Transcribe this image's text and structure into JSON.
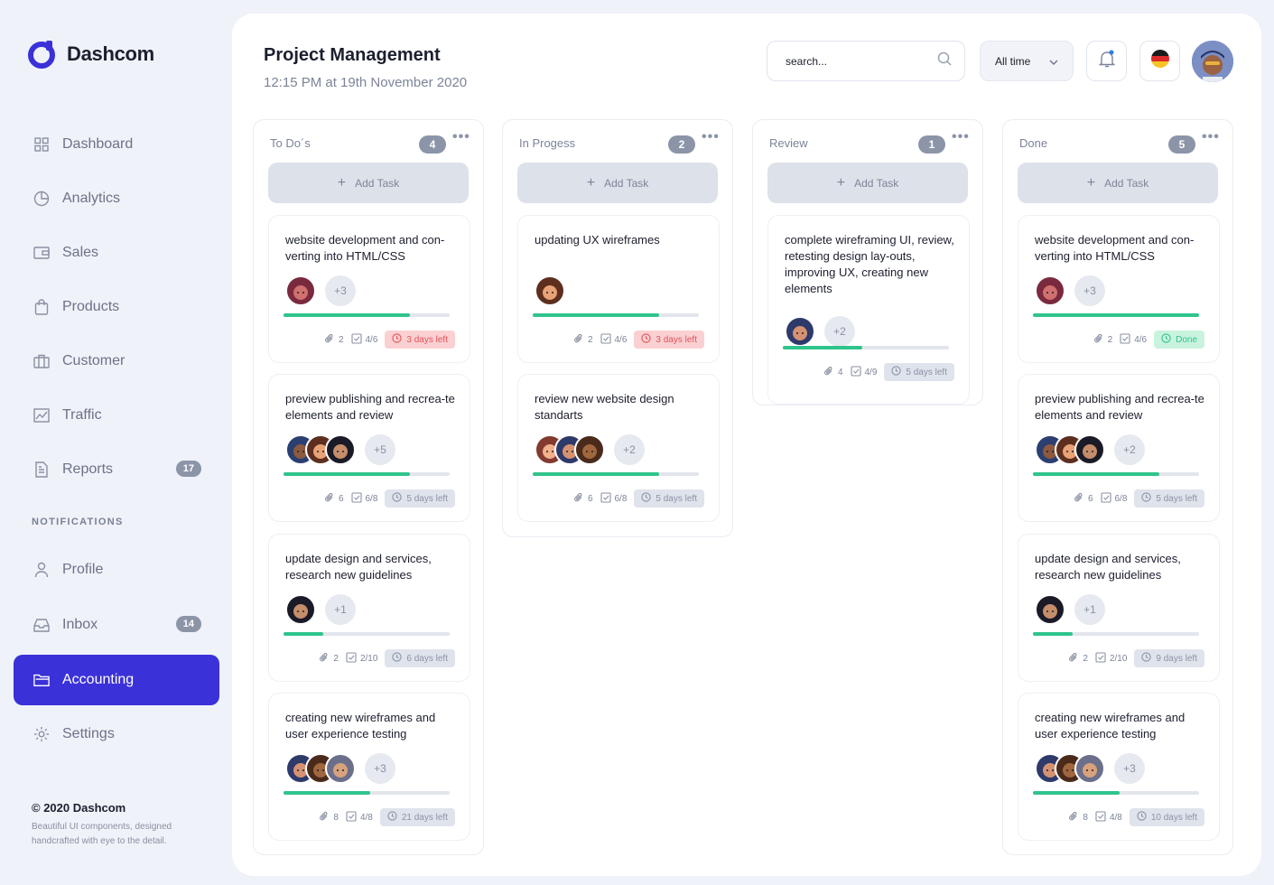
{
  "brand": {
    "name": "Dashcom"
  },
  "sidebar": {
    "items": [
      {
        "label": "Dashboard",
        "icon": "grid-icon"
      },
      {
        "label": "Analytics",
        "icon": "pie-chart-icon"
      },
      {
        "label": "Sales",
        "icon": "wallet-icon"
      },
      {
        "label": "Products",
        "icon": "shopping-bag-icon"
      },
      {
        "label": "Customer",
        "icon": "briefcase-icon"
      },
      {
        "label": "Traffic",
        "icon": "line-chart-icon"
      },
      {
        "label": "Reports",
        "icon": "document-icon",
        "badge": "17"
      }
    ],
    "section_label": "NOTIFICATIONS",
    "items2": [
      {
        "label": "Profile",
        "icon": "user-icon"
      },
      {
        "label": "Inbox",
        "icon": "inbox-icon",
        "badge": "14"
      },
      {
        "label": "Accounting",
        "icon": "folder-icon",
        "active": true
      },
      {
        "label": "Settings",
        "icon": "gear-icon"
      }
    ],
    "footer": {
      "copyright": "© 2020 Dashcom",
      "note": "Beautiful UI components, designed handcrafted with eye to the detail."
    }
  },
  "header": {
    "title": "Project Management",
    "subtitle": "12:15 PM at 19th November 2020",
    "search_placeholder": "search...",
    "filter_value": "All time"
  },
  "colors": {
    "accent": "#3b31d8",
    "progress": "#2fc48b",
    "badge": "#8c95a8"
  },
  "board": {
    "add_task_label": "Add Task",
    "columns": [
      {
        "title": "To Do´s",
        "count": "4",
        "cards": [
          {
            "title": "website development and con-verting into HTML/CSS",
            "more": "+3",
            "progress": 0.76,
            "attachments": "2",
            "checks": "4/6",
            "due": "3 days left",
            "due_style": "red"
          },
          {
            "title": "preview publishing and recrea-te elements and review",
            "more": "+5",
            "progress": 0.76,
            "attachments": "6",
            "checks": "6/8",
            "due": "5 days left",
            "due_style": "gray"
          },
          {
            "title": "update design and services, research new guidelines",
            "more": "+1",
            "progress": 0.24,
            "attachments": "2",
            "checks": "2/10",
            "due": "6 days left",
            "due_style": "gray"
          },
          {
            "title": "creating new wireframes and user experience testing",
            "more": "+3",
            "progress": 0.52,
            "attachments": "8",
            "checks": "4/8",
            "due": "21 days left",
            "due_style": "gray"
          }
        ]
      },
      {
        "title": "In Progess",
        "count": "2",
        "cards": [
          {
            "title": "updating UX wireframes",
            "more": "",
            "progress": 0.76,
            "attachments": "2",
            "checks": "4/6",
            "due": "3 days left",
            "due_style": "red"
          },
          {
            "title": "review new website design standarts",
            "more": "+2",
            "progress": 0.76,
            "attachments": "6",
            "checks": "6/8",
            "due": "5 days left",
            "due_style": "gray"
          }
        ]
      },
      {
        "title": "Review",
        "count": "1",
        "cards": [
          {
            "title": "complete wireframing UI, review, retesting design lay-outs, improving UX, creating new elements",
            "more": "+2",
            "progress": 0.48,
            "attachments": "4",
            "checks": "4/9",
            "due": "5 days left",
            "due_style": "gray"
          }
        ]
      },
      {
        "title": "Done",
        "count": "5",
        "cards": [
          {
            "title": "website development and con-verting into HTML/CSS",
            "more": "+3",
            "progress": 1.0,
            "attachments": "2",
            "checks": "4/6",
            "due": "Done",
            "due_style": "green"
          },
          {
            "title": "preview publishing and recrea-te elements and review",
            "more": "+2",
            "progress": 0.76,
            "attachments": "6",
            "checks": "6/8",
            "due": "5 days left",
            "due_style": "gray"
          },
          {
            "title": "update design and services, research new guidelines",
            "more": "+1",
            "progress": 0.24,
            "attachments": "2",
            "checks": "2/10",
            "due": "9 days left",
            "due_style": "gray"
          },
          {
            "title": "creating new wireframes and user experience testing",
            "more": "+3",
            "progress": 0.52,
            "attachments": "8",
            "checks": "4/8",
            "due": "10 days left",
            "due_style": "gray"
          }
        ]
      }
    ]
  }
}
